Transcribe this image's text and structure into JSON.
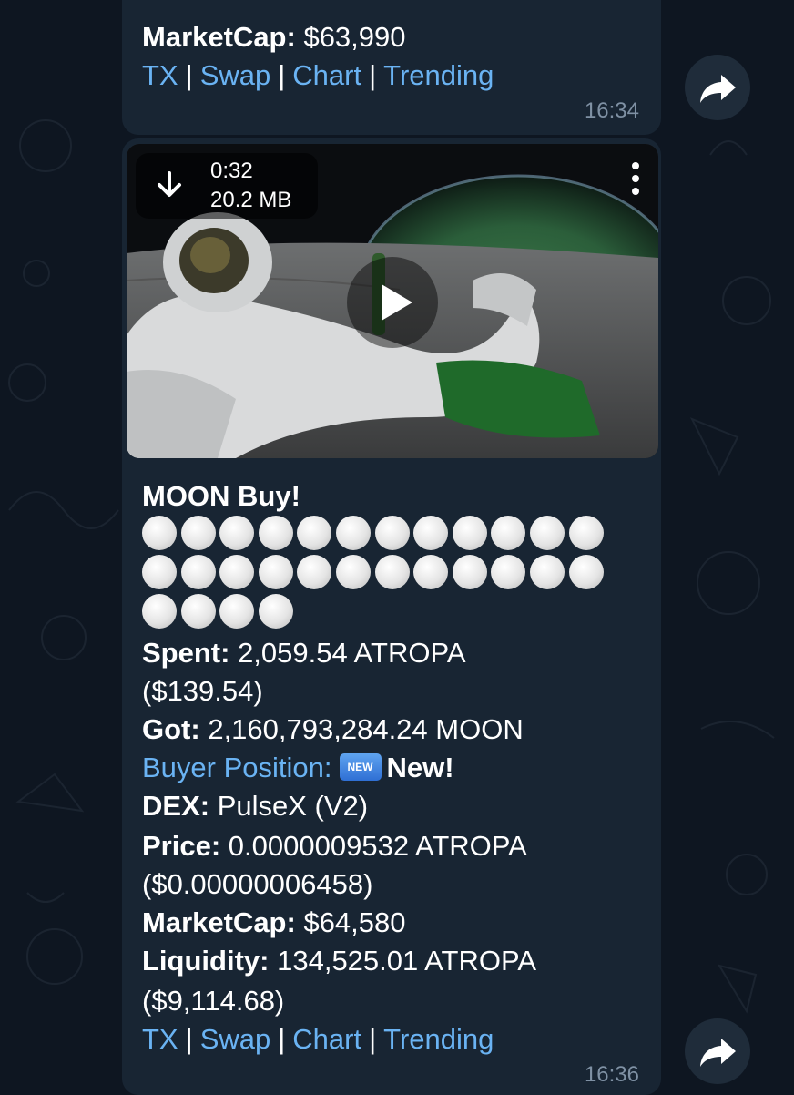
{
  "message1": {
    "partial_top": "`",
    "marketcap_label": "MarketCap:",
    "marketcap_value": "$63,990",
    "links": {
      "tx": "TX",
      "swap": "Swap",
      "chart": "Chart",
      "trending": "Trending",
      "sep": "|"
    },
    "time": "16:34"
  },
  "message2": {
    "media": {
      "duration": "0:32",
      "size": "20.2 MB",
      "icons": {
        "download": "download-arrow-icon",
        "menu": "more-vertical-icon",
        "play": "play-icon"
      }
    },
    "title": "MOON Buy!",
    "circle_count": 28,
    "spent_label": "Spent:",
    "spent_value": "2,059.54 ATROPA",
    "spent_usd": "($139.54)",
    "got_label": "Got:",
    "got_value": "2,160,793,284.24 MOON",
    "buyer_position_label": "Buyer Position:",
    "new_badge": "NEW",
    "buyer_position_value": "New!",
    "dex_label": "DEX:",
    "dex_value": "PulseX (V2)",
    "price_label": "Price:",
    "price_value": "0.0000009532 ATROPA",
    "price_usd": "($0.00000006458)",
    "marketcap_label": "MarketCap:",
    "marketcap_value": "$64,580",
    "liquidity_label": "Liquidity:",
    "liquidity_value": "134,525.01 ATROPA",
    "liquidity_usd": "($9,114.68)",
    "links": {
      "tx": "TX",
      "swap": "Swap",
      "chart": "Chart",
      "trending": "Trending",
      "sep": "|"
    },
    "time": "16:36"
  },
  "share_icon": "share-forward-icon",
  "colors": {
    "background": "#0e1621",
    "bubble": "#182533",
    "link": "#6ab3f3",
    "time": "#7f91a4"
  }
}
